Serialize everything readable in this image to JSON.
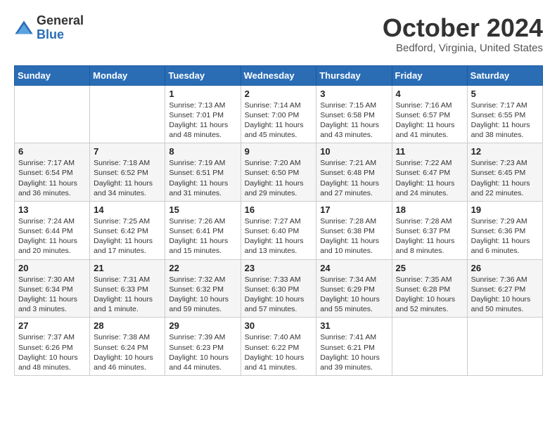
{
  "header": {
    "logo_general": "General",
    "logo_blue": "Blue",
    "title": "October 2024",
    "location": "Bedford, Virginia, United States"
  },
  "days_of_week": [
    "Sunday",
    "Monday",
    "Tuesday",
    "Wednesday",
    "Thursday",
    "Friday",
    "Saturday"
  ],
  "weeks": [
    [
      {
        "day": "",
        "info": ""
      },
      {
        "day": "",
        "info": ""
      },
      {
        "day": "1",
        "info": "Sunrise: 7:13 AM\nSunset: 7:01 PM\nDaylight: 11 hours and 48 minutes."
      },
      {
        "day": "2",
        "info": "Sunrise: 7:14 AM\nSunset: 7:00 PM\nDaylight: 11 hours and 45 minutes."
      },
      {
        "day": "3",
        "info": "Sunrise: 7:15 AM\nSunset: 6:58 PM\nDaylight: 11 hours and 43 minutes."
      },
      {
        "day": "4",
        "info": "Sunrise: 7:16 AM\nSunset: 6:57 PM\nDaylight: 11 hours and 41 minutes."
      },
      {
        "day": "5",
        "info": "Sunrise: 7:17 AM\nSunset: 6:55 PM\nDaylight: 11 hours and 38 minutes."
      }
    ],
    [
      {
        "day": "6",
        "info": "Sunrise: 7:17 AM\nSunset: 6:54 PM\nDaylight: 11 hours and 36 minutes."
      },
      {
        "day": "7",
        "info": "Sunrise: 7:18 AM\nSunset: 6:52 PM\nDaylight: 11 hours and 34 minutes."
      },
      {
        "day": "8",
        "info": "Sunrise: 7:19 AM\nSunset: 6:51 PM\nDaylight: 11 hours and 31 minutes."
      },
      {
        "day": "9",
        "info": "Sunrise: 7:20 AM\nSunset: 6:50 PM\nDaylight: 11 hours and 29 minutes."
      },
      {
        "day": "10",
        "info": "Sunrise: 7:21 AM\nSunset: 6:48 PM\nDaylight: 11 hours and 27 minutes."
      },
      {
        "day": "11",
        "info": "Sunrise: 7:22 AM\nSunset: 6:47 PM\nDaylight: 11 hours and 24 minutes."
      },
      {
        "day": "12",
        "info": "Sunrise: 7:23 AM\nSunset: 6:45 PM\nDaylight: 11 hours and 22 minutes."
      }
    ],
    [
      {
        "day": "13",
        "info": "Sunrise: 7:24 AM\nSunset: 6:44 PM\nDaylight: 11 hours and 20 minutes."
      },
      {
        "day": "14",
        "info": "Sunrise: 7:25 AM\nSunset: 6:42 PM\nDaylight: 11 hours and 17 minutes."
      },
      {
        "day": "15",
        "info": "Sunrise: 7:26 AM\nSunset: 6:41 PM\nDaylight: 11 hours and 15 minutes."
      },
      {
        "day": "16",
        "info": "Sunrise: 7:27 AM\nSunset: 6:40 PM\nDaylight: 11 hours and 13 minutes."
      },
      {
        "day": "17",
        "info": "Sunrise: 7:28 AM\nSunset: 6:38 PM\nDaylight: 11 hours and 10 minutes."
      },
      {
        "day": "18",
        "info": "Sunrise: 7:28 AM\nSunset: 6:37 PM\nDaylight: 11 hours and 8 minutes."
      },
      {
        "day": "19",
        "info": "Sunrise: 7:29 AM\nSunset: 6:36 PM\nDaylight: 11 hours and 6 minutes."
      }
    ],
    [
      {
        "day": "20",
        "info": "Sunrise: 7:30 AM\nSunset: 6:34 PM\nDaylight: 11 hours and 3 minutes."
      },
      {
        "day": "21",
        "info": "Sunrise: 7:31 AM\nSunset: 6:33 PM\nDaylight: 11 hours and 1 minute."
      },
      {
        "day": "22",
        "info": "Sunrise: 7:32 AM\nSunset: 6:32 PM\nDaylight: 10 hours and 59 minutes."
      },
      {
        "day": "23",
        "info": "Sunrise: 7:33 AM\nSunset: 6:30 PM\nDaylight: 10 hours and 57 minutes."
      },
      {
        "day": "24",
        "info": "Sunrise: 7:34 AM\nSunset: 6:29 PM\nDaylight: 10 hours and 55 minutes."
      },
      {
        "day": "25",
        "info": "Sunrise: 7:35 AM\nSunset: 6:28 PM\nDaylight: 10 hours and 52 minutes."
      },
      {
        "day": "26",
        "info": "Sunrise: 7:36 AM\nSunset: 6:27 PM\nDaylight: 10 hours and 50 minutes."
      }
    ],
    [
      {
        "day": "27",
        "info": "Sunrise: 7:37 AM\nSunset: 6:26 PM\nDaylight: 10 hours and 48 minutes."
      },
      {
        "day": "28",
        "info": "Sunrise: 7:38 AM\nSunset: 6:24 PM\nDaylight: 10 hours and 46 minutes."
      },
      {
        "day": "29",
        "info": "Sunrise: 7:39 AM\nSunset: 6:23 PM\nDaylight: 10 hours and 44 minutes."
      },
      {
        "day": "30",
        "info": "Sunrise: 7:40 AM\nSunset: 6:22 PM\nDaylight: 10 hours and 41 minutes."
      },
      {
        "day": "31",
        "info": "Sunrise: 7:41 AM\nSunset: 6:21 PM\nDaylight: 10 hours and 39 minutes."
      },
      {
        "day": "",
        "info": ""
      },
      {
        "day": "",
        "info": ""
      }
    ]
  ]
}
